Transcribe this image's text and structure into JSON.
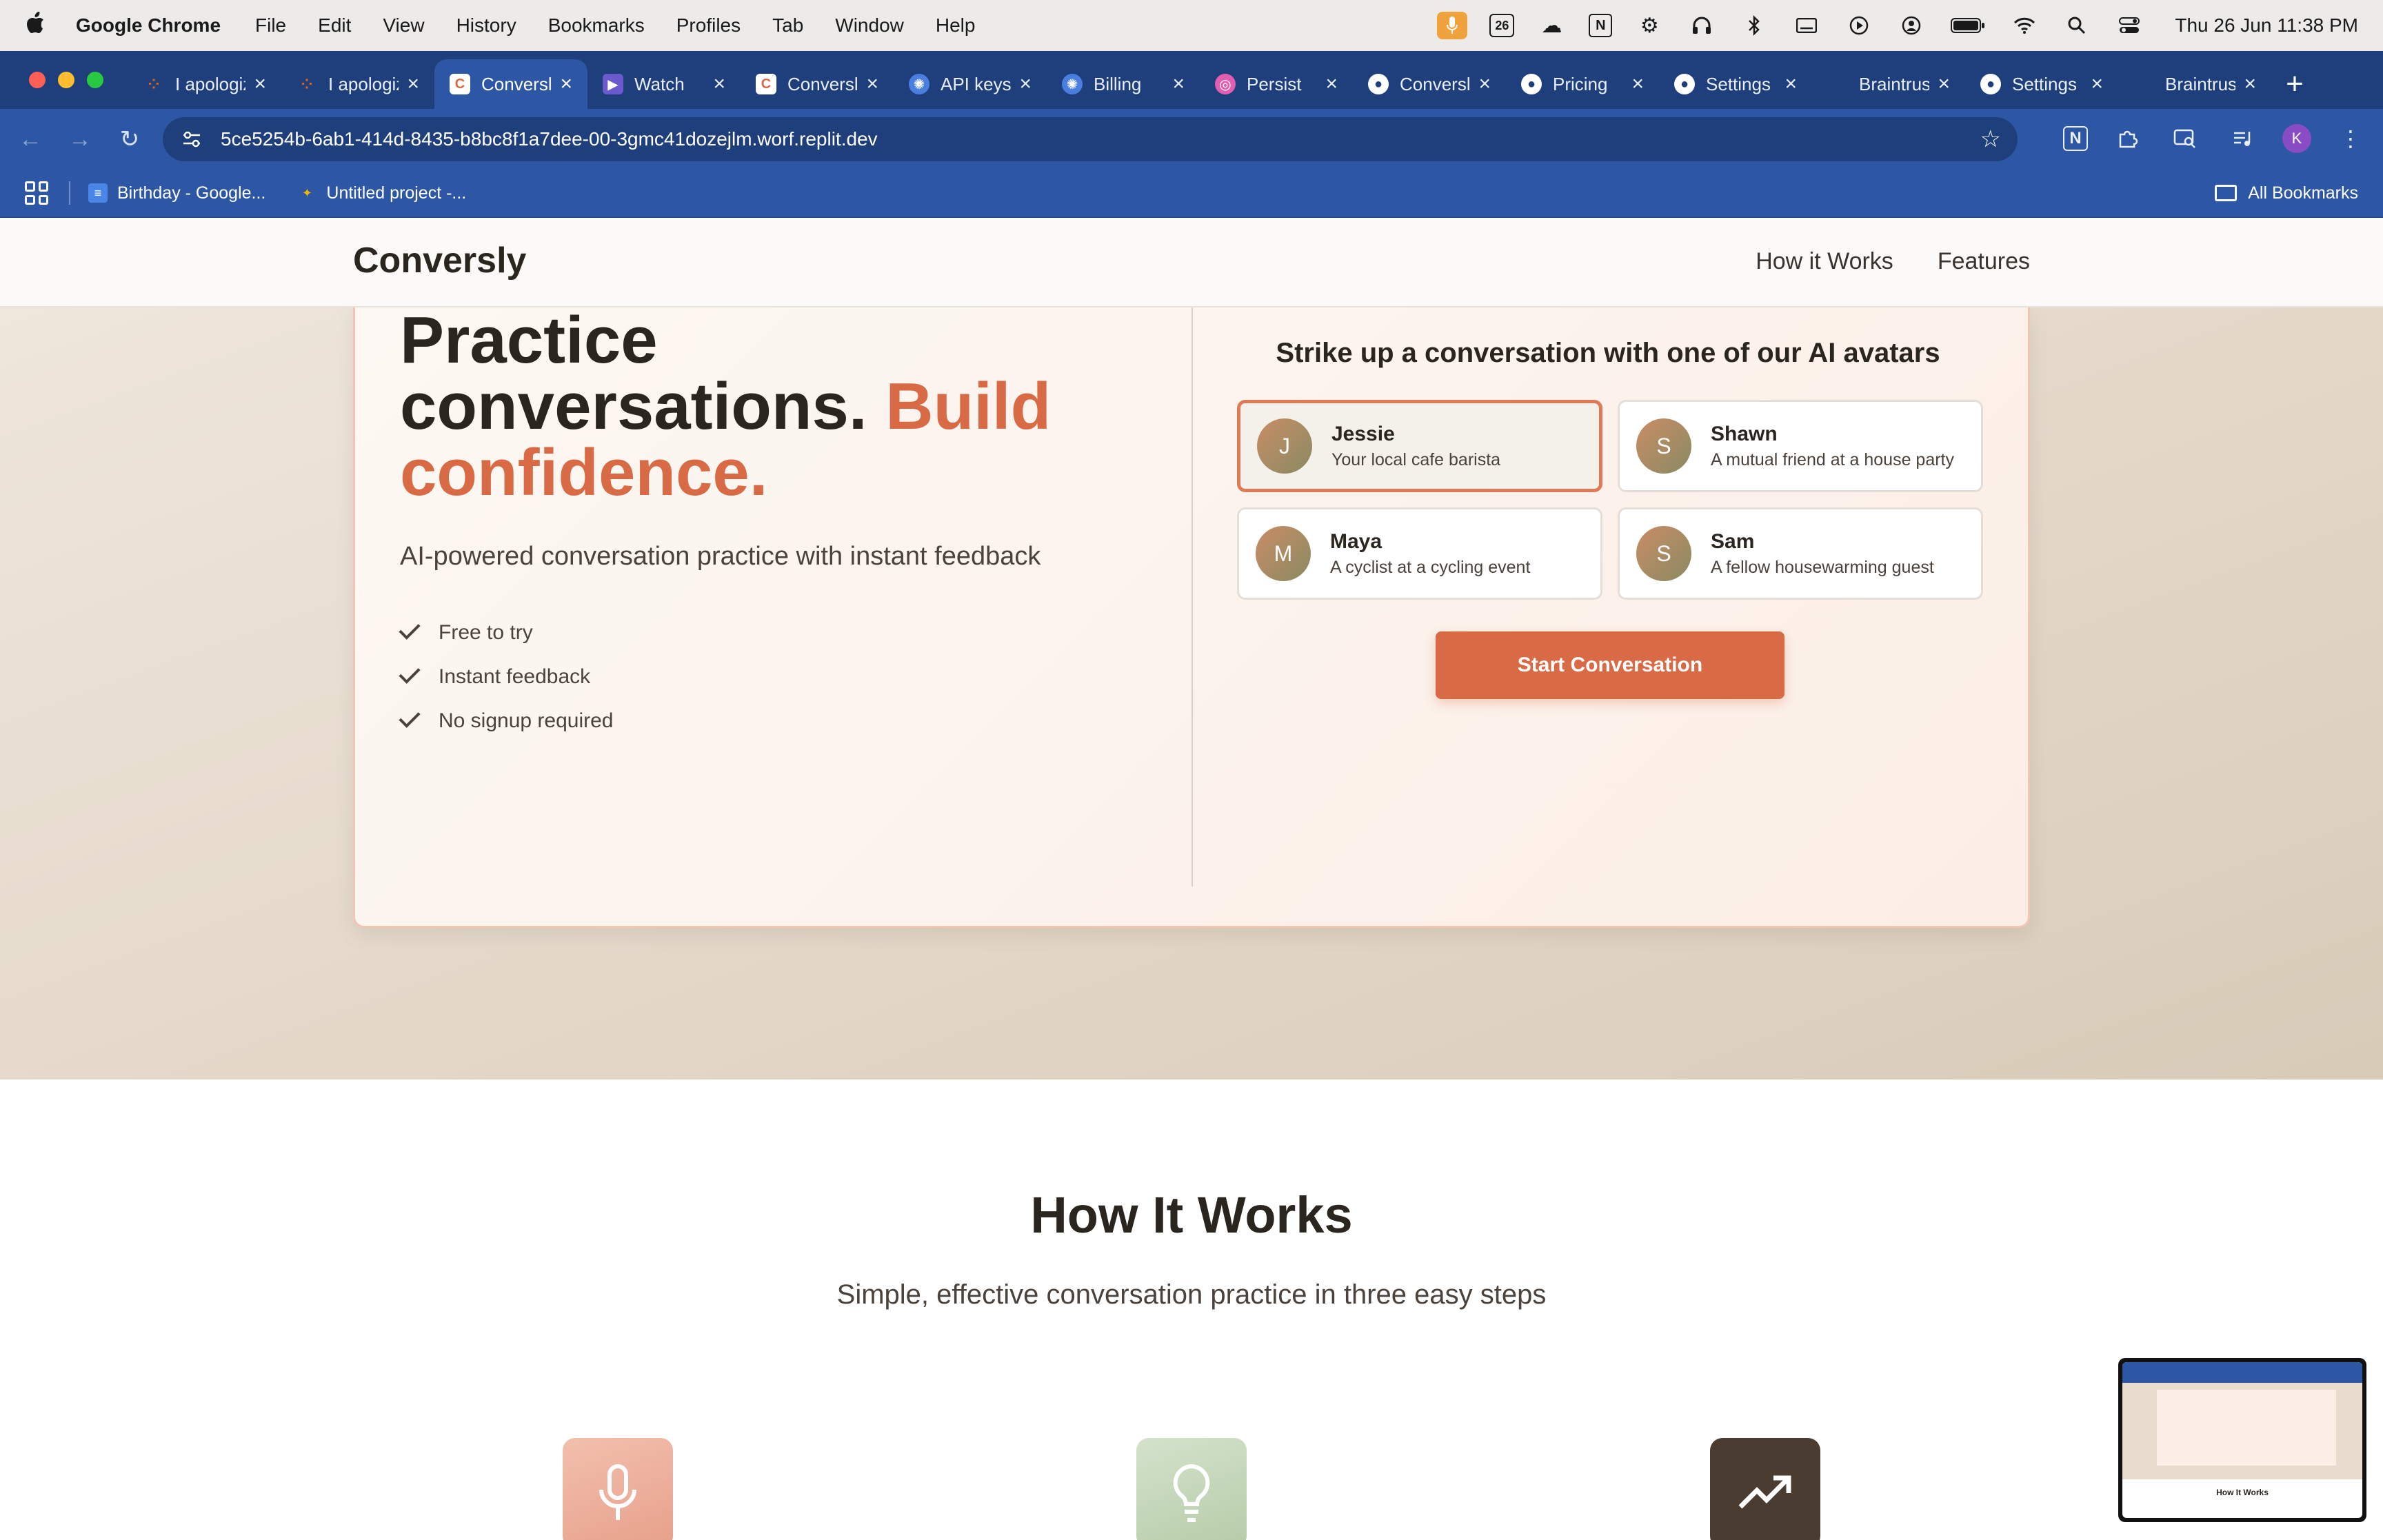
{
  "menubar": {
    "app_name": "Google Chrome",
    "items": [
      "File",
      "Edit",
      "View",
      "History",
      "Bookmarks",
      "Profiles",
      "Tab",
      "Window",
      "Help"
    ],
    "calendar_badge": "26",
    "clock": "Thu 26 Jun  11:38 PM"
  },
  "tabs": [
    {
      "title": "I apologize",
      "active": false,
      "favicon": "replit-icon"
    },
    {
      "title": "I apologize",
      "active": false,
      "favicon": "replit-icon"
    },
    {
      "title": "Conversly",
      "active": true,
      "favicon": "conversly-icon"
    },
    {
      "title": "Watch",
      "active": false,
      "favicon": "video-icon"
    },
    {
      "title": "Conversly",
      "active": false,
      "favicon": "conversly-icon"
    },
    {
      "title": "API keys",
      "active": false,
      "favicon": "openai-icon"
    },
    {
      "title": "Billing",
      "active": false,
      "favicon": "openai-icon"
    },
    {
      "title": "Persist",
      "active": false,
      "favicon": "persist-icon"
    },
    {
      "title": "Conversly",
      "active": false,
      "favicon": "chat-icon"
    },
    {
      "title": "Pricing",
      "active": false,
      "favicon": "chat-icon"
    },
    {
      "title": "Settings",
      "active": false,
      "favicon": "chat-icon"
    },
    {
      "title": "Braintrust",
      "active": false,
      "favicon": "braintrust-icon"
    },
    {
      "title": "Settings",
      "active": false,
      "favicon": "chat-icon"
    },
    {
      "title": "Braintrust",
      "active": false,
      "favicon": "braintrust-icon"
    }
  ],
  "toolbar": {
    "url": "5ce5254b-6ab1-414d-8435-b8bc8f1a7dee-00-3gmc41dozejlm.worf.replit.dev",
    "profile_initial": "K"
  },
  "bookmarks": {
    "items": [
      "Birthday - Google...",
      "Untitled project -..."
    ],
    "all_label": "All Bookmarks"
  },
  "site": {
    "brand": "Conversly",
    "nav": [
      "How it Works",
      "Features"
    ],
    "hero": {
      "title_line1": "Practice",
      "title_line2": "conversations.",
      "title_accent": "Build confidence.",
      "subtitle": "AI-powered conversation practice with instant feedback",
      "features": [
        "Free to try",
        "Instant feedback",
        "No signup required"
      ]
    },
    "avatars": {
      "heading": "Strike up a conversation with one of our AI avatars",
      "items": [
        {
          "initial": "J",
          "name": "Jessie",
          "desc": "Your local cafe barista",
          "selected": true
        },
        {
          "initial": "S",
          "name": "Shawn",
          "desc": "A mutual friend at a house party",
          "selected": false
        },
        {
          "initial": "M",
          "name": "Maya",
          "desc": "A cyclist at a cycling event",
          "selected": false
        },
        {
          "initial": "S",
          "name": "Sam",
          "desc": "A fellow housewarming guest",
          "selected": false
        }
      ],
      "start_label": "Start Conversation"
    },
    "how_it_works": {
      "title": "How It Works",
      "subtitle": "Simple, effective conversation practice in three easy steps",
      "step_icons": [
        "microphone-icon",
        "lightbulb-icon",
        "trending-up-icon"
      ]
    }
  },
  "thumbnail": {
    "caption": "How It Works"
  },
  "colors": {
    "accent": "#d96a46",
    "chrome_blue": "#2d56a4",
    "chrome_dark": "#1e3f7c"
  }
}
